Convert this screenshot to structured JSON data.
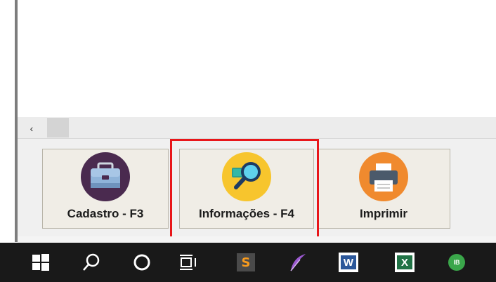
{
  "window": {
    "scroll_left_glyph": "‹"
  },
  "toolbar": {
    "buttons": [
      {
        "label": "Cadastro - F3",
        "icon": "toolbox-icon"
      },
      {
        "label": "Informações - F4",
        "icon": "magnifier-info-icon"
      },
      {
        "label": "Imprimir",
        "icon": "printer-icon"
      }
    ]
  },
  "taskbar": {
    "apps": [
      {
        "name": "start-button",
        "icon": "windows-logo-icon"
      },
      {
        "name": "search",
        "icon": "search-icon"
      },
      {
        "name": "cortana",
        "icon": "cortana-icon"
      },
      {
        "name": "task-view",
        "icon": "task-view-icon"
      },
      {
        "name": "sublime-text",
        "icon": "sublime-text-icon",
        "letter": "S"
      },
      {
        "name": "quill",
        "icon": "feather-icon"
      },
      {
        "name": "word",
        "icon": "word-icon",
        "letter": "W"
      },
      {
        "name": "excel",
        "icon": "excel-icon",
        "letter": "X"
      },
      {
        "name": "ibexpert",
        "icon": "ibexpert-icon",
        "letter": "IB"
      }
    ]
  },
  "colors": {
    "highlight": "#e8161a",
    "cadastro_icon": "#4a2a4f",
    "info_icon": "#f7c52d",
    "imprimir_icon": "#f08a2e",
    "taskbar": "#191919"
  }
}
